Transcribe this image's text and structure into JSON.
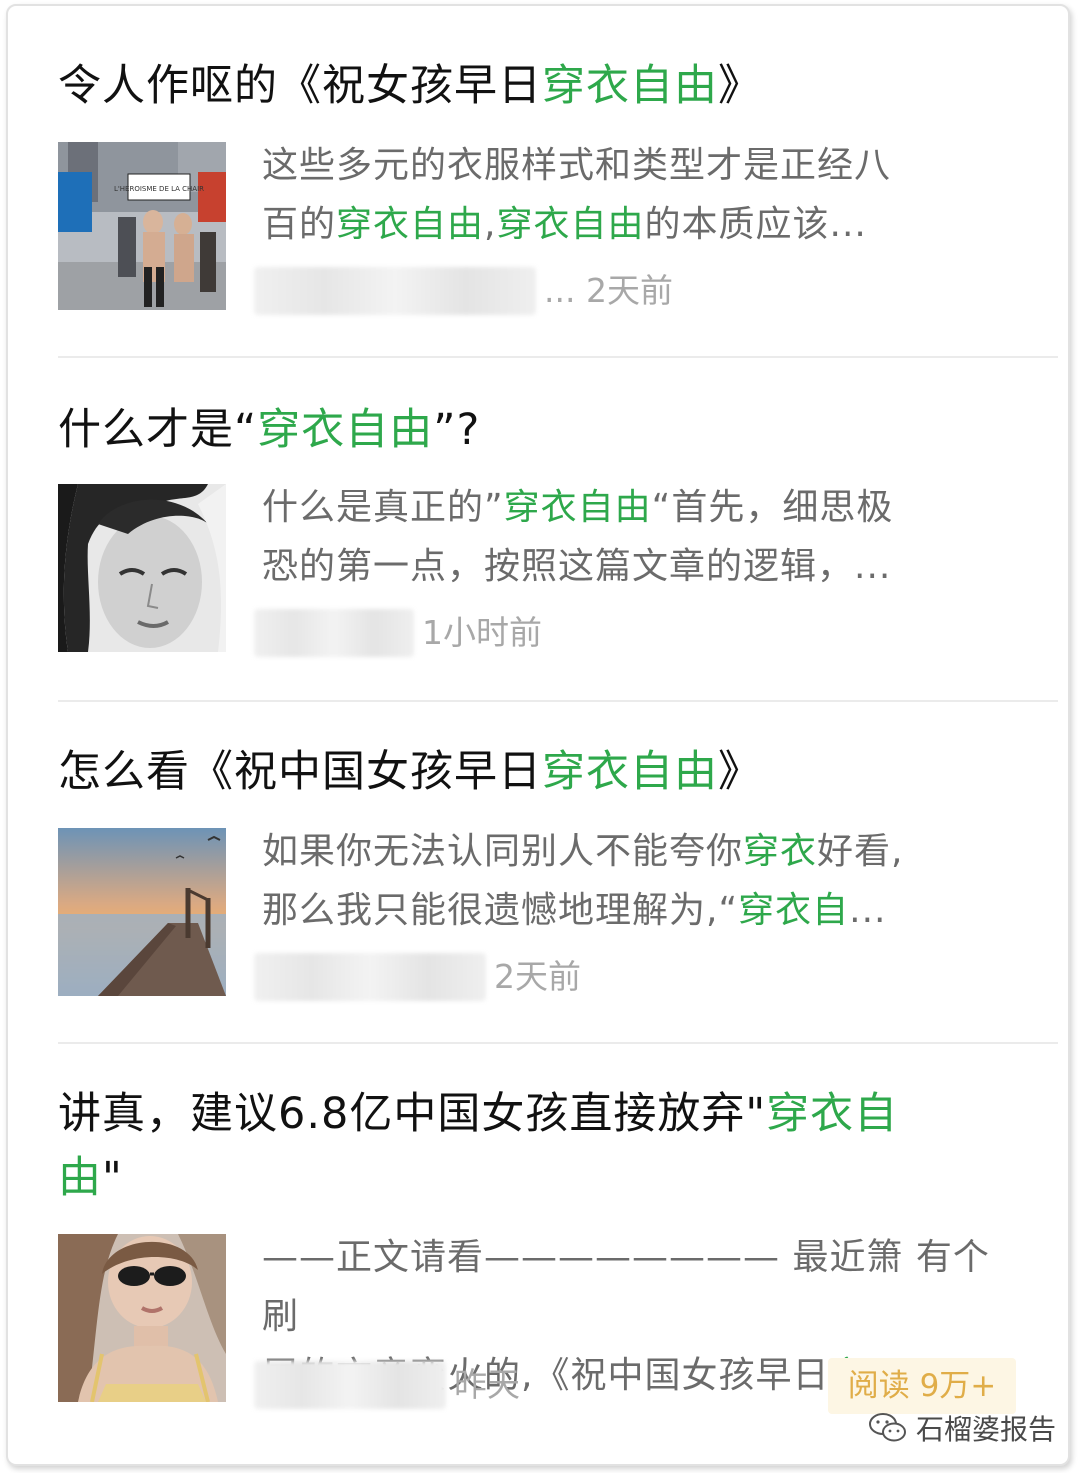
{
  "results": [
    {
      "title_before": "令人作呕的《祝女孩早日",
      "title_highlight": "穿衣自由",
      "title_after": "》",
      "snippet_line1": "这些多元的衣服样式和类型才是正经八",
      "snippet_line2_before": "百的",
      "snippet_line2_hl1": "穿衣自由",
      "snippet_line2_mid": ",",
      "snippet_line2_hl2": "穿衣自由",
      "snippet_line2_after": "的本质应该...",
      "meta_suffix": "... 2天前",
      "thumb_sign_text": "L'HEROISME DE LA CHAIR"
    },
    {
      "title_before": "什么才是“",
      "title_highlight": "穿衣自由",
      "title_after": "”?",
      "snippet_line1_before": "什么是真正的”",
      "snippet_line1_hl": "穿衣自由",
      "snippet_line1_after": "“首先，细思极",
      "snippet_line2": "恐的第一点，按照这篇文章的逻辑，...",
      "meta_suffix": "1小时前"
    },
    {
      "title_before": "怎么看《祝中国女孩早日",
      "title_highlight": "穿衣自由",
      "title_after": "》",
      "snippet_line1_before": "如果你无法认同别人不能夸你",
      "snippet_line1_hl": "穿衣",
      "snippet_line1_after": "好看,",
      "snippet_line2_before": "那么我只能很遗憾地理解为,“",
      "snippet_line2_hl": "穿衣自",
      "snippet_line2_after": "...",
      "meta_suffix": "2天前"
    },
    {
      "title_line1_before": "讲真，建议6.8亿中国女孩直接放弃\"",
      "title_line1_hl": "穿衣自",
      "title_line2_hl": "由",
      "title_line2_after": "\"",
      "snippet_line1": "——正文请看———————— 最近箫 有个刷",
      "snippet_line2_before": "屏的文章蛮火的,《祝中国女孩早日",
      "snippet_line2_hl": "穿",
      "snippet_line2_after": "...",
      "meta_suffix": "昨天",
      "read_badge": "阅读 9万+"
    }
  ],
  "watermark": "石榴婆报告",
  "colors": {
    "highlight": "#2ea84b",
    "title": "#111111",
    "snippet": "#6b6b6b",
    "meta": "#a8a8a8",
    "badge_bg": "#fdf6e4",
    "badge_text": "#e0ad48"
  }
}
